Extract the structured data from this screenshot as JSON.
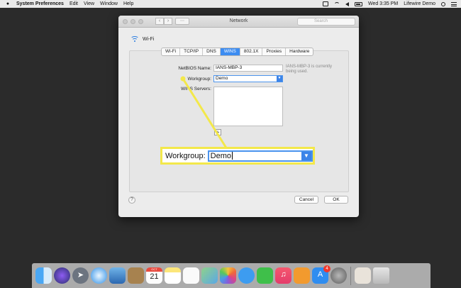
{
  "menubar": {
    "app_name": "System Preferences",
    "items": [
      "Edit",
      "View",
      "Window",
      "Help"
    ],
    "clock": "Wed 3:35 PM",
    "user": "Lifewire Demo"
  },
  "window": {
    "title": "Network",
    "search_placeholder": "Search",
    "interface_name": "Wi-Fi",
    "tabs": [
      "Wi-Fi",
      "TCP/IP",
      "DNS",
      "WINS",
      "802.1X",
      "Proxies",
      "Hardware"
    ],
    "active_tab": "WINS",
    "netbios_label": "NetBIOS Name:",
    "netbios_value": "IANS-MBP-3",
    "netbios_note": "IANS-MBP-3 is currently being used.",
    "workgroup_label": "Workgroup:",
    "workgroup_value": "Demo",
    "wins_servers_label": "WINS Servers:",
    "add_symbol": "+",
    "help_symbol": "?",
    "cancel_label": "Cancel",
    "ok_label": "OK"
  },
  "callout": {
    "label": "Workgroup:",
    "value": "Demo",
    "highlight_color": "#f3e84a"
  },
  "dock": {
    "calendar_month": "OCT",
    "calendar_day": "21",
    "appstore_badge": "4"
  },
  "colors": {
    "accent": "#3c8cf1",
    "desktop": "#2b2b2b"
  }
}
